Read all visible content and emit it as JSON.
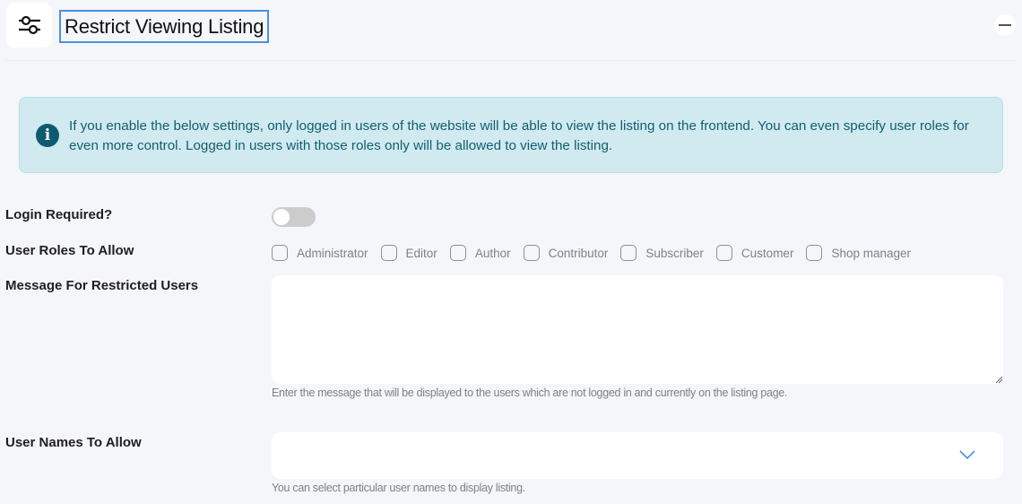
{
  "header": {
    "icon": "sliders-icon",
    "title": "Restrict Viewing Listing",
    "collapse_icon": "minus-icon"
  },
  "notice": {
    "icon": "info-icon",
    "icon_glyph": "i",
    "text": "If you enable the below settings, only logged in users of the website will be able to view the listing on the frontend. You can even specify user roles for even more control. Logged in users with those roles only will be allowed to view the listing."
  },
  "fields": {
    "login_required": {
      "label": "Login Required?",
      "value": false
    },
    "user_roles": {
      "label": "User Roles To Allow",
      "options": [
        {
          "label": "Administrator",
          "checked": false
        },
        {
          "label": "Editor",
          "checked": false
        },
        {
          "label": "Author",
          "checked": false
        },
        {
          "label": "Contributor",
          "checked": false
        },
        {
          "label": "Subscriber",
          "checked": false
        },
        {
          "label": "Customer",
          "checked": false
        },
        {
          "label": "Shop manager",
          "checked": false
        }
      ]
    },
    "restricted_message": {
      "label": "Message For Restricted Users",
      "value": "",
      "help": "Enter the message that will be displayed to the users which are not logged in and currently on the listing page."
    },
    "user_names": {
      "label": "User Names To Allow",
      "value": "",
      "help": "You can select particular user names to display listing.",
      "dropdown_icon": "chevron-down-icon"
    }
  },
  "colors": {
    "accent": "#4a90e2",
    "notice_bg": "#d0eaf0",
    "notice_text": "#135e72",
    "info_icon": "#0e5a6e",
    "page_bg": "#f5f6fa",
    "toggle_off": "#cccccc"
  }
}
